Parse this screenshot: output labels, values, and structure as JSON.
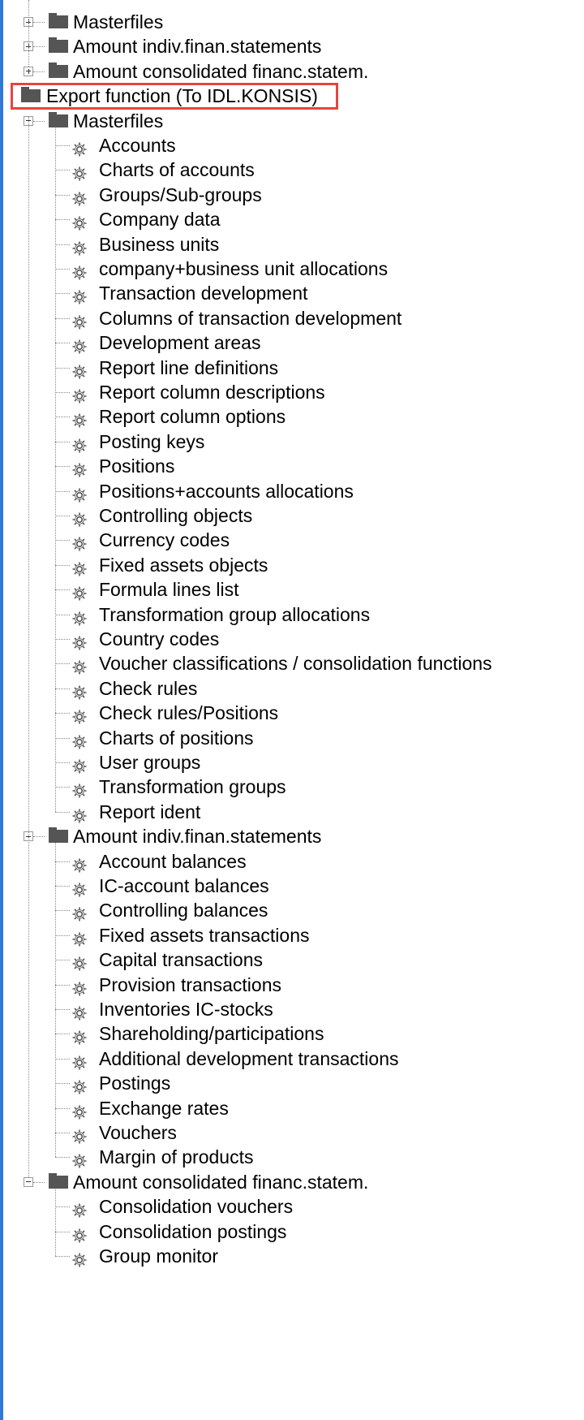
{
  "tree": {
    "top_nodes": [
      {
        "label": "Masterfiles",
        "expander": "plus"
      },
      {
        "label": "Amount indiv.finan.statements",
        "expander": "plus"
      },
      {
        "label": "Amount consolidated financ.statem.",
        "expander": "plus"
      }
    ],
    "export": {
      "label": "Export function (To IDL.KONSIS)",
      "groups": [
        {
          "label": "Masterfiles",
          "expander": "minus",
          "items": [
            "Accounts",
            "Charts of accounts",
            "Groups/Sub-groups",
            "Company data",
            "Business units",
            "company+business unit allocations",
            "Transaction development",
            "Columns of transaction development",
            "Development areas",
            "Report line definitions",
            "Report column descriptions",
            "Report column options",
            "Posting keys",
            "Positions",
            "Positions+accounts allocations",
            "Controlling objects",
            "Currency codes",
            "Fixed assets objects",
            "Formula lines list",
            "Transformation group allocations",
            "Country codes",
            "Voucher classifications / consolidation functions",
            "Check rules",
            "Check rules/Positions",
            "Charts of positions",
            "User groups",
            "Transformation groups",
            "Report ident"
          ]
        },
        {
          "label": "Amount indiv.finan.statements",
          "expander": "minus",
          "items": [
            "Account balances",
            "IC-account balances",
            "Controlling balances",
            "Fixed assets transactions",
            "Capital transactions",
            "Provision transactions",
            "Inventories IC-stocks",
            "Shareholding/participations",
            "Additional development transactions",
            "Postings",
            "Exchange rates",
            "Vouchers",
            "Margin of products"
          ]
        },
        {
          "label": "Amount consolidated financ.statem.",
          "expander": "minus",
          "items": [
            "Consolidation vouchers",
            "Consolidation postings",
            "Group monitor"
          ]
        }
      ]
    }
  },
  "colors": {
    "highlight_border": "#e2463f",
    "left_border": "#2f7ad6",
    "folder": "#555555"
  }
}
